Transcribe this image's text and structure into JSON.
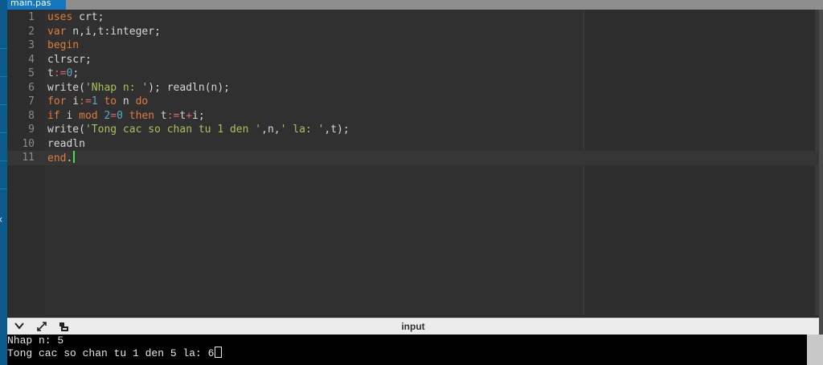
{
  "tab": {
    "label": "main.pas"
  },
  "editor": {
    "lines": [
      {
        "n": "1",
        "tokens": [
          [
            "kw",
            "uses"
          ],
          [
            "id",
            " crt;"
          ]
        ]
      },
      {
        "n": "2",
        "tokens": [
          [
            "kw",
            "var"
          ],
          [
            "id",
            " n,i,t:integer;"
          ]
        ]
      },
      {
        "n": "3",
        "tokens": [
          [
            "kw",
            "begin"
          ]
        ]
      },
      {
        "n": "4",
        "tokens": [
          [
            "id",
            "clrscr;"
          ]
        ]
      },
      {
        "n": "5",
        "tokens": [
          [
            "id",
            "t"
          ],
          [
            "op",
            ":="
          ],
          [
            "num",
            "0"
          ],
          [
            "id",
            ";"
          ]
        ]
      },
      {
        "n": "6",
        "tokens": [
          [
            "id",
            "write("
          ],
          [
            "str",
            "'Nhap n: '"
          ],
          [
            "id",
            "); readln(n);"
          ]
        ]
      },
      {
        "n": "7",
        "tokens": [
          [
            "kw",
            "for"
          ],
          [
            "id",
            " i"
          ],
          [
            "op",
            ":="
          ],
          [
            "num",
            "1"
          ],
          [
            "id",
            " "
          ],
          [
            "kw",
            "to"
          ],
          [
            "id",
            " n "
          ],
          [
            "kw",
            "do"
          ]
        ]
      },
      {
        "n": "8",
        "tokens": [
          [
            "kw",
            "if"
          ],
          [
            "id",
            " i "
          ],
          [
            "kw",
            "mod"
          ],
          [
            "id",
            " "
          ],
          [
            "num",
            "2"
          ],
          [
            "op",
            "="
          ],
          [
            "num",
            "0"
          ],
          [
            "id",
            " "
          ],
          [
            "kw",
            "then"
          ],
          [
            "id",
            " t"
          ],
          [
            "op",
            ":="
          ],
          [
            "id",
            "t"
          ],
          [
            "op",
            "+"
          ],
          [
            "id",
            "i;"
          ]
        ]
      },
      {
        "n": "9",
        "tokens": [
          [
            "id",
            "write("
          ],
          [
            "str",
            "'Tong cac so chan tu 1 den '"
          ],
          [
            "id",
            ",n,"
          ],
          [
            "str",
            "' la: '"
          ],
          [
            "id",
            ",t);"
          ]
        ]
      },
      {
        "n": "10",
        "tokens": [
          [
            "id",
            "readln"
          ]
        ]
      },
      {
        "n": "11",
        "tokens": [
          [
            "kw",
            "end"
          ],
          [
            "id",
            "."
          ]
        ]
      }
    ]
  },
  "panel": {
    "title": "input",
    "icons": [
      "chevron-down-icon",
      "expand-icon",
      "keyboard-icon"
    ]
  },
  "console": {
    "lines": [
      "Nhap n: 5",
      "Tong cac so chan tu 1 den 5 la: 6"
    ]
  },
  "colors": {
    "keyword": "#e07b3b",
    "string": "#a6c25c",
    "number": "#5aa8c9",
    "operator": "#d66a6a",
    "cursor": "#3fe43f"
  }
}
